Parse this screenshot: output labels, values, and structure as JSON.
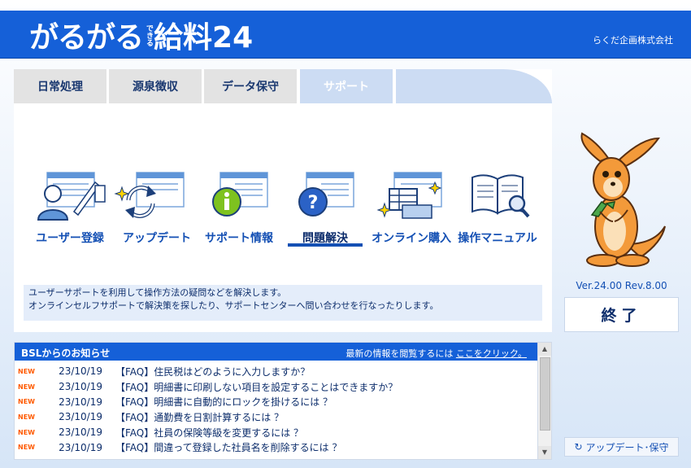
{
  "header": {
    "logo_main": "がるがる",
    "logo_small": "できる",
    "logo_product": "給料24",
    "company": "らくだ企画株式会社"
  },
  "tabs": [
    {
      "label": "日常処理",
      "active": false
    },
    {
      "label": "源泉徴収",
      "active": false
    },
    {
      "label": "データ保守",
      "active": false
    },
    {
      "label": "サポート",
      "active": true
    }
  ],
  "icons": [
    {
      "label": "ユーザー登録",
      "icon": "user-registration-icon"
    },
    {
      "label": "アップデート",
      "icon": "update-icon"
    },
    {
      "label": "サポート情報",
      "icon": "info-icon"
    },
    {
      "label": "問題解決",
      "icon": "question-icon",
      "active": true
    },
    {
      "label": "オンライン購入",
      "icon": "online-purchase-icon"
    },
    {
      "label": "操作マニュアル",
      "icon": "manual-icon"
    }
  ],
  "description": {
    "line1": "ユーザーサポートを利用して操作方法の疑問などを解決します。",
    "line2": "オンラインセルフサポートで解決策を探したり、サポートセンターへ問い合わせを行なったりします。"
  },
  "news": {
    "title": "BSLからのお知らせ",
    "hint_prefix": "最新の情報を閲覧するには",
    "hint_link": "ここをクリック。",
    "items": [
      {
        "badge": "NEW",
        "date": "23/10/19",
        "text": "【FAQ】住民税はどのように入力しますか？"
      },
      {
        "badge": "NEW",
        "date": "23/10/19",
        "text": "【FAQ】明細書に印刷しない項目を設定することはできますか？"
      },
      {
        "badge": "NEW",
        "date": "23/10/19",
        "text": "【FAQ】明細書に自動的にロックを掛けるには ？"
      },
      {
        "badge": "NEW",
        "date": "23/10/19",
        "text": "【FAQ】通勤費を日割計算するには ？"
      },
      {
        "badge": "NEW",
        "date": "23/10/19",
        "text": "【FAQ】社員の保険等級を変更するには ？"
      },
      {
        "badge": "NEW",
        "date": "23/10/19",
        "text": "【FAQ】間違って登録した社員名を削除するには ？"
      }
    ]
  },
  "version": "Ver.24.00 Rev.8.00",
  "exit_label": "終了",
  "update_backup_label": "アップデート･保守",
  "colors": {
    "header_blue": "#1560d8",
    "link_blue": "#1450b4",
    "new_badge": "#ff5a00"
  }
}
